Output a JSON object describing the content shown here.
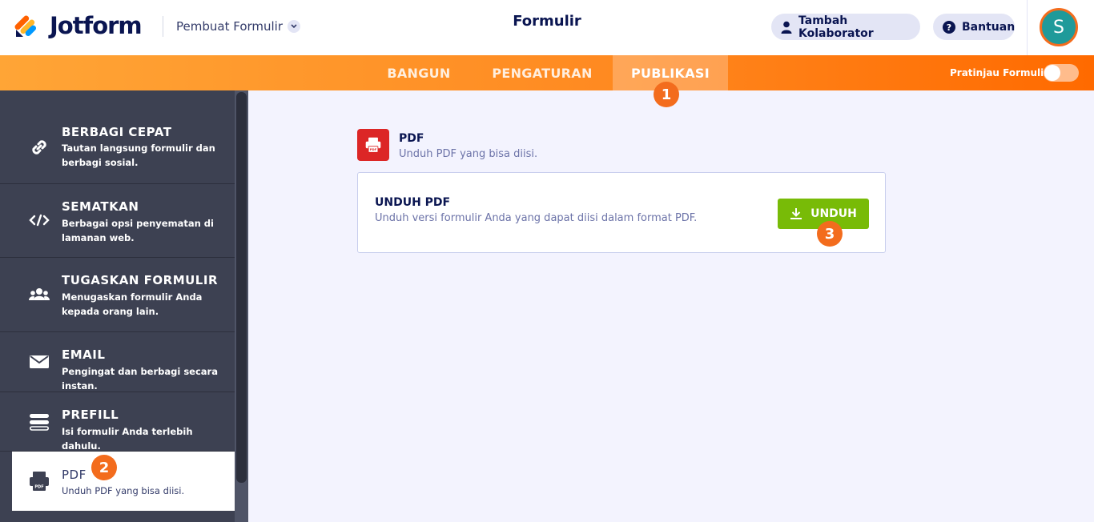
{
  "header": {
    "brand": "Jotform",
    "builder_menu": "Pembuat Formulir",
    "page_title": "Formulir",
    "collab_button": "Tambah Kolaborator",
    "help_button": "Bantuan",
    "avatar_initial": "S"
  },
  "nav": {
    "tabs": [
      "BANGUN",
      "PENGATURAN",
      "PUBLIKASI"
    ],
    "active_tab": "PUBLIKASI",
    "preview_label": "Pratinjau Formulir",
    "preview_enabled": false
  },
  "sidebar": {
    "items": [
      {
        "title": "BERBAGI CEPAT",
        "desc": "Tautan langsung formulir dan berbagi sosial.",
        "icon": "link-icon"
      },
      {
        "title": "SEMATKAN",
        "desc": "Berbagai opsi penyematan di lamanan web.",
        "icon": "code-icon"
      },
      {
        "title": "TUGASKAN FORMULIR",
        "desc": "Menugaskan formulir Anda kepada orang lain.",
        "icon": "users-icon"
      },
      {
        "title": "EMAIL",
        "desc": "Pengingat dan berbagi secara instan.",
        "icon": "envelope-icon"
      },
      {
        "title": "PREFILL",
        "desc": "Isi formulir Anda terlebih dahulu.",
        "icon": "prefill-icon"
      },
      {
        "title": "PDF",
        "desc": "Unduh PDF yang bisa diisi.",
        "icon": "pdf-icon"
      }
    ],
    "active_item": "PDF"
  },
  "main": {
    "section_title": "PDF",
    "section_sub": "Unduh PDF yang bisa diisi.",
    "card_title": "UNDUH PDF",
    "card_sub": "Unduh versi formulir Anda yang dapat diisi dalam format PDF.",
    "download_button": "UNDUH"
  },
  "badges": [
    "1",
    "2",
    "3"
  ],
  "colors": {
    "accent_orange": "#ff6a00",
    "download_green": "#78bb07",
    "pdf_red": "#dc2626",
    "sidebar_dark": "#3d4152",
    "navy_text": "#0a1551"
  }
}
